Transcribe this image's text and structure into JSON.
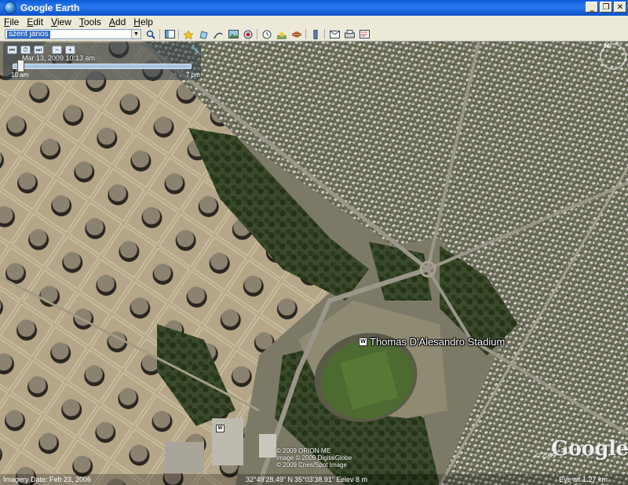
{
  "window": {
    "title": "Google Earth",
    "controls": {
      "minimize": "_",
      "maximize": "❐",
      "close": "✕"
    }
  },
  "menu": {
    "items": [
      {
        "first": "F",
        "rest": "ile"
      },
      {
        "first": "E",
        "rest": "dit"
      },
      {
        "first": "V",
        "rest": "iew"
      },
      {
        "first": "T",
        "rest": "ools"
      },
      {
        "first": "A",
        "rest": "dd"
      },
      {
        "first": "H",
        "rest": "elp"
      }
    ]
  },
  "toolbar": {
    "search_value": "szent janos",
    "icons": [
      "search-icon",
      "sidebar-icon",
      "placemark-icon",
      "polygon-icon",
      "path-icon",
      "image-overlay-icon",
      "record-tour-icon",
      "historical-imagery-icon",
      "sunlight-icon",
      "planets-icon",
      "ruler-icon",
      "email-icon",
      "print-icon",
      "maps-icon"
    ]
  },
  "time_slider": {
    "date": "Mar 13, 2009  10:13 am",
    "start_label": "10 am",
    "end_label": "7 pm",
    "position": 0.04
  },
  "compass": {
    "north": "N"
  },
  "map": {
    "place_label": "Thomas D'Alesandro Stadium",
    "place_icon": "W",
    "road_shield": "W",
    "copyright_lines": [
      "© 2009 ORION-ME",
      "Image © 2009 DigitalGlobe",
      "© 2009 Cnes/Spot Image"
    ],
    "logo_year": "© 2009",
    "logo": "Google"
  },
  "status": {
    "imagery_date": "Imagery Date: Feb 23, 2006",
    "lat": "32°49'28.49\" N",
    "lon": "35°03'38.91\" E",
    "elev": "elev   8 m",
    "eye_alt": "Eye alt   1.27 km"
  },
  "colors": {
    "titlebar": "#0a5ad8",
    "chrome": "#ece9d8",
    "map_ground": "#8a8a6a",
    "tanks_area": "#b8a888"
  }
}
